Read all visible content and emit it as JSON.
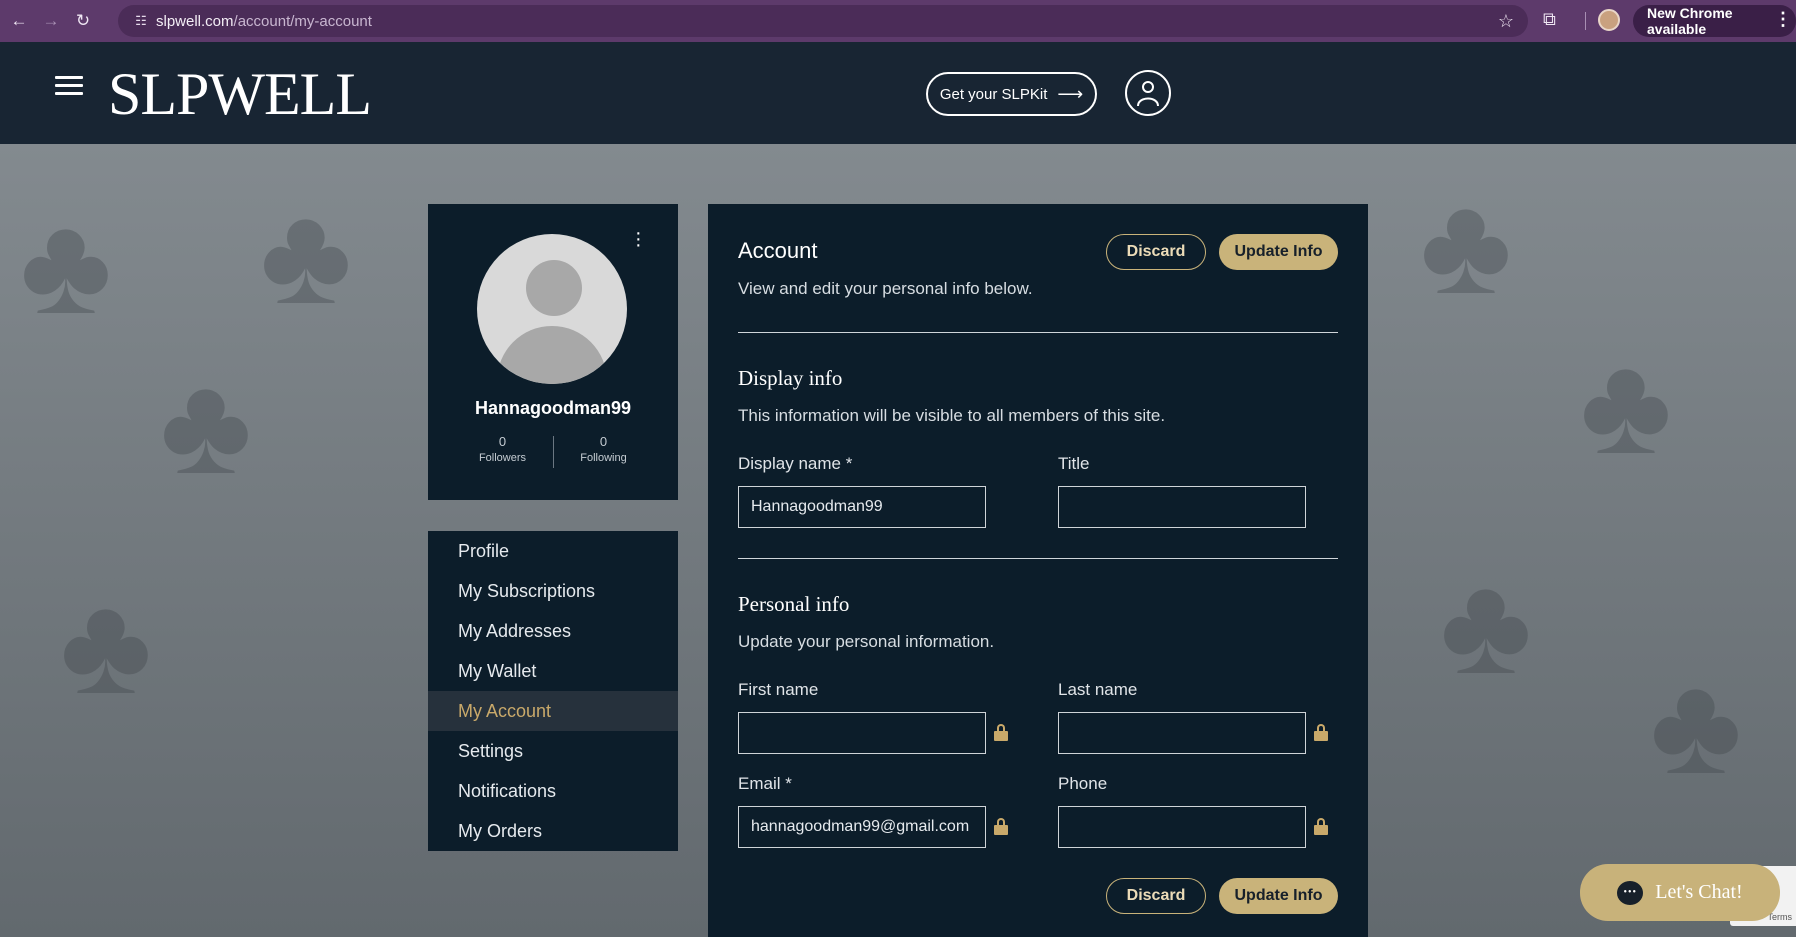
{
  "browser": {
    "url_host": "slpwell.com",
    "url_path": "/account/my-account",
    "update_label": "New Chrome available"
  },
  "header": {
    "logo": "SLPWELL",
    "kit_button": "Get your SLPKit"
  },
  "profile": {
    "username": "Hannagoodman99",
    "followers_count": "0",
    "followers_label": "Followers",
    "following_count": "0",
    "following_label": "Following"
  },
  "menu": {
    "items": [
      {
        "label": "Profile"
      },
      {
        "label": "My Subscriptions"
      },
      {
        "label": "My Addresses"
      },
      {
        "label": "My Wallet"
      },
      {
        "label": "My Account"
      },
      {
        "label": "Settings"
      },
      {
        "label": "Notifications"
      },
      {
        "label": "My Orders"
      }
    ],
    "active_index": 4
  },
  "account": {
    "title": "Account",
    "subtitle": "View and edit your personal info below.",
    "discard_label": "Discard",
    "update_label": "Update Info",
    "display_section": {
      "title": "Display info",
      "subtitle": "This information will be visible to all members of this site.",
      "display_name_label": "Display name *",
      "display_name_value": "Hannagoodman99",
      "title_label": "Title",
      "title_value": ""
    },
    "personal_section": {
      "title": "Personal info",
      "subtitle": "Update your personal information.",
      "first_name_label": "First name",
      "first_name_value": "",
      "last_name_label": "Last name",
      "last_name_value": "",
      "email_label": "Email *",
      "email_value": "hannagoodman99@gmail.com",
      "phone_label": "Phone",
      "phone_value": ""
    }
  },
  "chat": {
    "label": "Let's Chat!"
  },
  "recaptcha": {
    "label": "Terms"
  },
  "colors": {
    "accent_gold": "#c9b37a",
    "panel_navy": "#0c1d2a",
    "header_navy": "#182533",
    "browser_purple": "#5d3a6b"
  }
}
